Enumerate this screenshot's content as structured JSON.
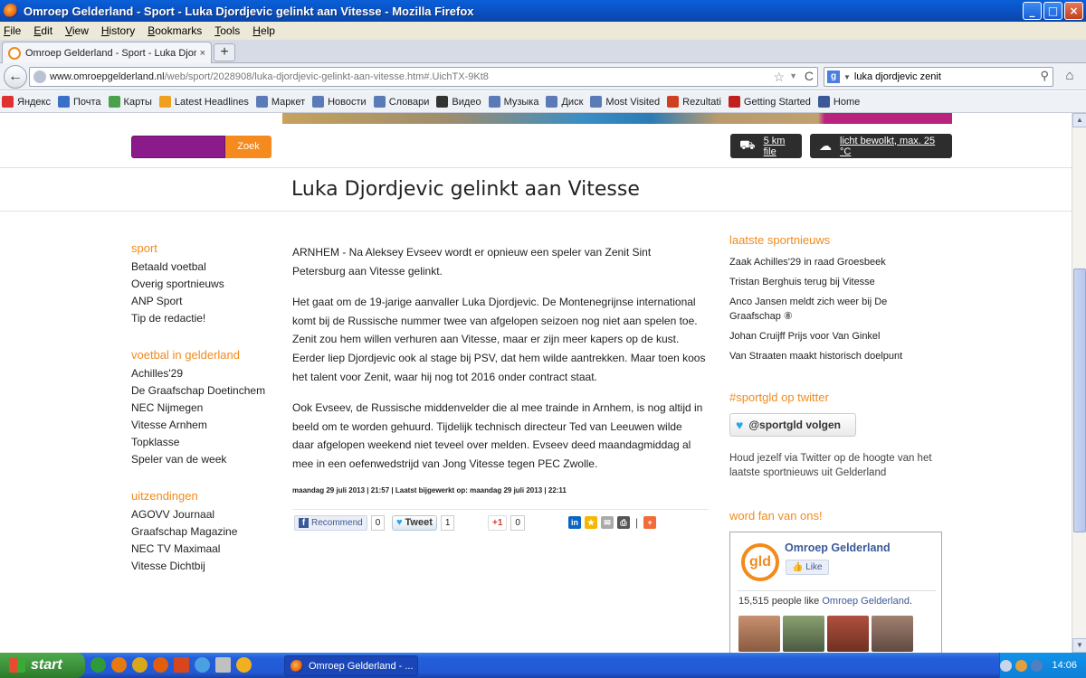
{
  "window": {
    "title": "Omroep Gelderland - Sport - Luka Djordjevic gelinkt aan Vitesse - Mozilla Firefox",
    "buttons": {
      "minimize": "_",
      "maximize": "□",
      "close": "×"
    }
  },
  "menu": [
    "File",
    "Edit",
    "View",
    "History",
    "Bookmarks",
    "Tools",
    "Help"
  ],
  "tab": {
    "label": "Omroep Gelderland - Sport - Luka Djordjevic ...",
    "close": "×",
    "new_tab": "+"
  },
  "nav": {
    "back": "←",
    "url_host": "www.omroepgelderland.nl",
    "url_path": "/web/sport/2028908/luka-djordjevic-gelinkt-aan-vitesse.htm#.UichTX-9Kt8",
    "star": "☆",
    "dropdown": "▼",
    "reload": "C",
    "search_engine": "g",
    "search_value": "luka djordjevic zenit",
    "search_button": "⚲",
    "home": "⌂"
  },
  "bookmarks": [
    {
      "label": "Яндекс",
      "color": "#e03030"
    },
    {
      "label": "Почта",
      "color": "#3a70c8"
    },
    {
      "label": "Карты",
      "color": "#4aa34a"
    },
    {
      "label": "Latest Headlines",
      "color": "#f0a020"
    },
    {
      "label": "Маркет",
      "color": "#5a7ab8"
    },
    {
      "label": "Новости",
      "color": "#5a7ab8"
    },
    {
      "label": "Словари",
      "color": "#5a7ab8"
    },
    {
      "label": "Видео",
      "color": "#333333"
    },
    {
      "label": "Музыка",
      "color": "#5a7ab8"
    },
    {
      "label": "Диск",
      "color": "#5a7ab8"
    },
    {
      "label": "Most Visited",
      "color": "#5a7ab8"
    },
    {
      "label": "Rezultati",
      "color": "#d04020"
    },
    {
      "label": "Getting Started",
      "color": "#c02020"
    },
    {
      "label": "Home",
      "color": "#3b5998"
    }
  ],
  "site": {
    "search_button": "Zoek",
    "traffic": "5 km file",
    "weather": "licht bewolkt, max. 25 °C"
  },
  "article": {
    "title": "Luka Djordjevic gelinkt aan Vitesse",
    "paragraphs": [
      "ARNHEM - Na Aleksey Evseev wordt er opnieuw een speler van Zenit Sint Petersburg aan Vitesse gelinkt.",
      "Het gaat om de 19-jarige aanvaller Luka Djordjevic. De Montenegrijnse international komt bij de Russische nummer twee van afgelopen seizoen nog niet aan spelen toe. Zenit zou hem willen verhuren aan Vitesse, maar er zijn meer kapers op de kust. Eerder liep Djordjevic ook al stage bij PSV, dat hem wilde aantrekken. Maar toen koos het talent voor Zenit, waar hij nog tot 2016 onder contract staat.",
      "Ook Evseev, de Russische middenvelder die al mee trainde in Arnhem, is nog altijd in beeld om te worden gehuurd. Tijdelijk technisch directeur Ted van Leeuwen wilde daar afgelopen weekend niet teveel over melden. Evseev deed maandagmiddag al mee in een oefenwedstrijd van Jong Vitesse tegen PEC Zwolle."
    ],
    "meta": "maandag 29 juli 2013 | 21:57 | Laatst bijgewerkt op: maandag 29 juli 2013 | 22:11",
    "share": {
      "fb_label": "Recommend",
      "fb_count": "0",
      "tw_label": "Tweet",
      "tw_count": "1",
      "g_label": "+1",
      "g_count": "0",
      "separator": "|",
      "plus": "+"
    }
  },
  "leftnav": [
    {
      "head": "sport",
      "items": [
        "Betaald voetbal",
        "Overig sportnieuws",
        "ANP Sport",
        "Tip de redactie!"
      ]
    },
    {
      "head": "voetbal in gelderland",
      "items": [
        "Achilles'29",
        "De Graafschap Doetinchem",
        "NEC Nijmegen",
        "Vitesse Arnhem",
        "Topklasse",
        "Speler van de week"
      ]
    },
    {
      "head": "uitzendingen",
      "items": [
        "AGOVV Journaal",
        "Graafschap Magazine",
        "NEC TV Maximaal",
        "Vitesse Dichtbij"
      ]
    }
  ],
  "right": {
    "news_head": "laatste sportnieuws",
    "news": [
      "Zaak Achilles'29 in raad Groesbeek",
      "Tristan Berghuis terug bij Vitesse",
      "Anco Jansen meldt zich weer bij De Graafschap ⑧",
      "Johan Cruijff Prijs voor Van Ginkel",
      "Van Straaten maakt historisch doelpunt"
    ],
    "twitter_head": "#sportgld op twitter",
    "twitter_button": "@sportgld volgen",
    "twitter_desc": "Houd jezelf via Twitter op de hoogte van het laatste sportnieuws uit Gelderland",
    "fan_head": "word fan van ons!",
    "fb_logo": "gld",
    "fb_name": "Omroep Gelderland",
    "fb_like": "Like",
    "fb_count_pre": "15,515 people like ",
    "fb_count_link": "Omroep Gelderland",
    "fb_count_post": "."
  },
  "taskbar": {
    "start": "start",
    "task": "Omroep Gelderland - ...",
    "clock": "14:06"
  },
  "scrollbar": {
    "up": "▲",
    "down": "▼"
  }
}
